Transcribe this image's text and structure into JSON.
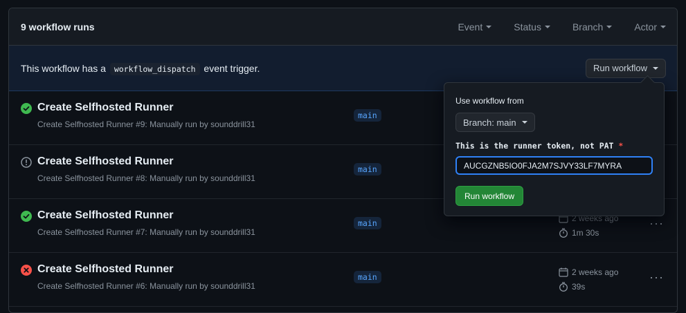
{
  "header": {
    "title": "9 workflow runs",
    "filters": [
      "Event",
      "Status",
      "Branch",
      "Actor"
    ]
  },
  "banner": {
    "text_before": "This workflow has a",
    "code": "workflow_dispatch",
    "text_after": "event trigger.",
    "run_button": "Run workflow"
  },
  "popover": {
    "use_label": "Use workflow from",
    "branch_button": "Branch: main",
    "token_label": "This is the runner token, not PAT",
    "required_mark": "*",
    "token_value": "AUCGZNB5IO0FJA2M7SJVY33LF7MYRA",
    "submit": "Run workflow"
  },
  "runs": [
    {
      "status": "success",
      "title": "Create Selfhosted Runner",
      "subtitle": "Create Selfhosted Runner #9: Manually run by sounddrill31",
      "branch": "main",
      "date": "",
      "duration": ""
    },
    {
      "status": "neutral",
      "title": "Create Selfhosted Runner",
      "subtitle": "Create Selfhosted Runner #8: Manually run by sounddrill31",
      "branch": "main",
      "date": "",
      "duration": ""
    },
    {
      "status": "success",
      "title": "Create Selfhosted Runner",
      "subtitle": "Create Selfhosted Runner #7: Manually run by sounddrill31",
      "branch": "main",
      "date": "2 weeks ago",
      "duration": "1m 30s"
    },
    {
      "status": "failure",
      "title": "Create Selfhosted Runner",
      "subtitle": "Create Selfhosted Runner #6: Manually run by sounddrill31",
      "branch": "main",
      "date": "2 weeks ago",
      "duration": "39s"
    }
  ],
  "colors": {
    "success": "#3fb950",
    "neutral": "#8b949e",
    "failure": "#f85149",
    "accent": "#2f81f7",
    "primary_button": "#238636"
  }
}
